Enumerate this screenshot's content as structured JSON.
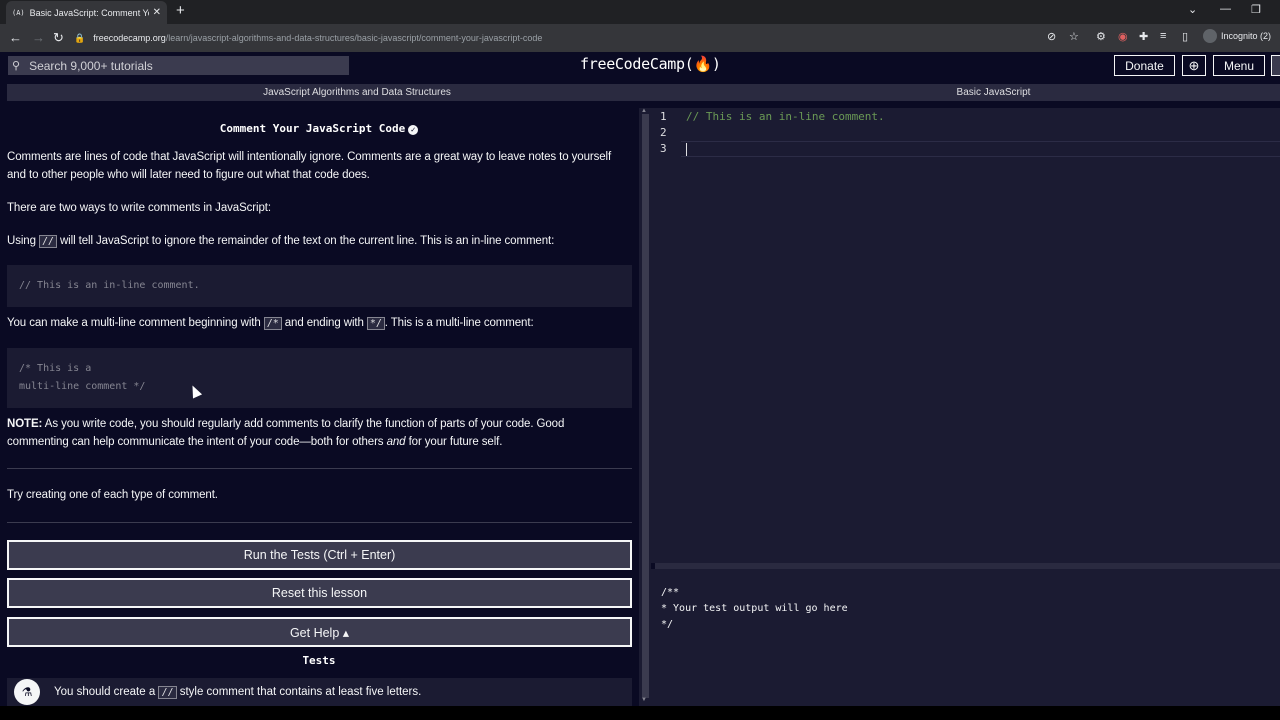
{
  "browser": {
    "tab_title": "Basic JavaScript: Comment Your",
    "tab_favicon": "(A)",
    "new_tab_symbol": "+",
    "url_host": "freecodecamp.org",
    "url_path": "/learn/javascript-algorithms-and-data-structures/basic-javascript/comment-your-javascript-code",
    "incognito_label": "Incognito (2)"
  },
  "header": {
    "search_placeholder": "Search 9,000+ tutorials",
    "logo": "freeCodeCamp(🔥)",
    "donate_label": "Donate",
    "menu_label": "Menu"
  },
  "breadcrumbs": {
    "left": "JavaScript Algorithms and Data Structures",
    "right": "Basic JavaScript"
  },
  "challenge": {
    "title": "Comment Your JavaScript Code",
    "p1": "Comments are lines of code that JavaScript will intentionally ignore. Comments are a great way to leave notes to yourself and to other people who will later need to figure out what that code does.",
    "p2": "There are two ways to write comments in JavaScript:",
    "p3_before": "Using",
    "p3_code": "//",
    "p3_after": "will tell JavaScript to ignore the remainder of the text on the current line. This is an in-line comment:",
    "code1": "// This is an in-line comment.",
    "p4_before": "You can make a multi-line comment beginning with",
    "p4_code1": "/*",
    "p4_mid": "and ending with",
    "p4_code2": "*/",
    "p4_after": ". This is a multi-line comment:",
    "code2_line1": "/* This is a",
    "code2_line2": "multi-line comment */",
    "note_label": "NOTE:",
    "note_text_1": "As you write code, you should regularly add comments to clarify the function of parts of your code. Good commenting can help communicate the intent of your code—both for others",
    "note_em": "and",
    "note_text_2": "for your future self.",
    "instructions": "Try creating one of each type of comment."
  },
  "buttons": {
    "run": "Run the Tests (Ctrl + Enter)",
    "reset": "Reset this lesson",
    "help": "Get Help ▴"
  },
  "tests": {
    "heading": "Tests",
    "item_before": "You should create a",
    "item_code": "//",
    "item_after": "style comment that contains at least five letters."
  },
  "editor": {
    "line_numbers": [
      "1",
      "2",
      "3"
    ],
    "line1": "// This is an in-line comment."
  },
  "output": {
    "text": "/**\n* Your test output will go here\n*/"
  },
  "colors": {
    "background": "#0a0a23",
    "panel": "#1b1b32",
    "button": "#3b3b4f",
    "comment": "#6a9955"
  }
}
